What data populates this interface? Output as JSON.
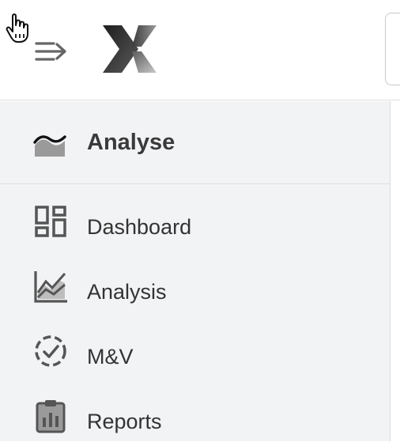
{
  "sidebar": {
    "section": {
      "label": "Analyse",
      "icon": "area-chart-icon"
    },
    "items": [
      {
        "label": "Dashboard",
        "icon": "dashboard-icon"
      },
      {
        "label": "Analysis",
        "icon": "line-chart-icon"
      },
      {
        "label": "M&V",
        "icon": "dashed-check-circle-icon"
      },
      {
        "label": "Reports",
        "icon": "clipboard-chart-icon"
      }
    ]
  },
  "colors": {
    "icon": "#555555",
    "text": "#333333",
    "sidebar_bg": "#f2f3f5"
  }
}
